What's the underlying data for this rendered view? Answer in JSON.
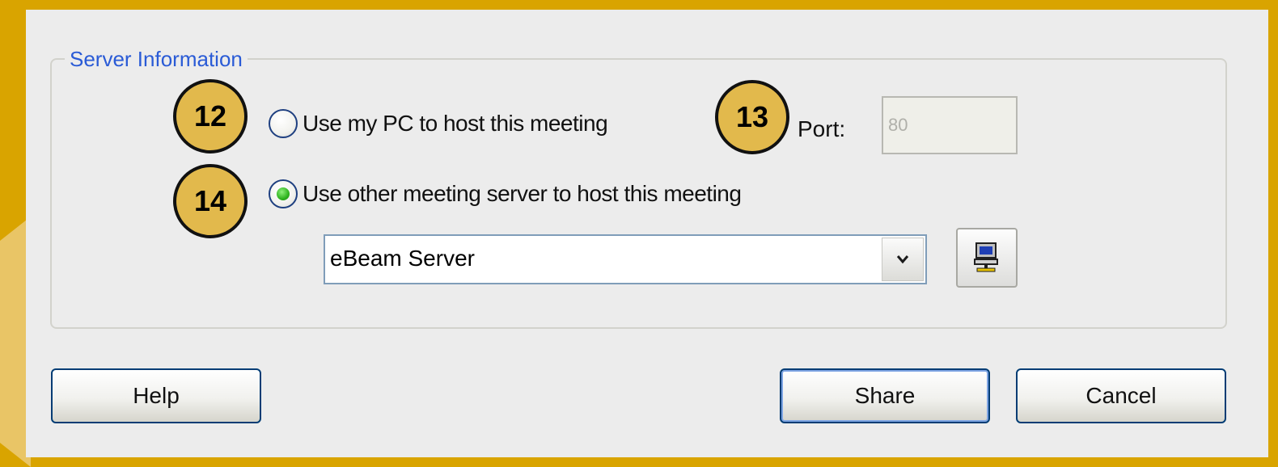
{
  "server_information": {
    "legend": "Server Information",
    "options": [
      {
        "label": "Use my PC to host this meeting",
        "checked": false
      },
      {
        "label": "Use other meeting server to host this meeting",
        "checked": true
      }
    ],
    "port": {
      "label": "Port:",
      "value": "80"
    },
    "server_select": {
      "selected": "eBeam Server"
    },
    "server_button_icon": "network-computer-icon"
  },
  "callouts": [
    "12",
    "13",
    "14"
  ],
  "buttons": {
    "help": "Help",
    "share": "Share",
    "cancel": "Cancel"
  },
  "colors": {
    "frame": "#d9a400",
    "callout_fill": "#e2b94c",
    "legend_text": "#2a5bd6",
    "radio_selected": "#2fb31f"
  }
}
